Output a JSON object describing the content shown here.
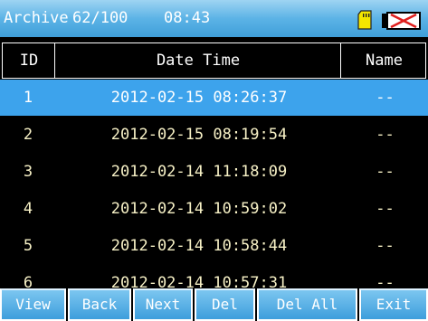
{
  "title_bar": {
    "title": "Archive",
    "record_count": "62/100",
    "time": "08:43",
    "icons": [
      "sd-card-icon",
      "battery-empty-icon"
    ],
    "colors": {
      "bar": "#4fa9e0",
      "sd_card": "#f3e600",
      "battery_x": "#e0201f"
    }
  },
  "table": {
    "columns": [
      "ID",
      "Date Time",
      "Name"
    ],
    "rows": [
      {
        "id": "1",
        "datetime": "2012-02-15 08:26:37",
        "name": "--",
        "selected": true
      },
      {
        "id": "2",
        "datetime": "2012-02-15 08:19:54",
        "name": "--",
        "selected": false
      },
      {
        "id": "3",
        "datetime": "2012-02-14 11:18:09",
        "name": "--",
        "selected": false
      },
      {
        "id": "4",
        "datetime": "2012-02-14 10:59:02",
        "name": "--",
        "selected": false
      },
      {
        "id": "5",
        "datetime": "2012-02-14 10:58:44",
        "name": "--",
        "selected": false
      },
      {
        "id": "6",
        "datetime": "2012-02-14 10:57:31",
        "name": "--",
        "selected": false
      }
    ],
    "colors": {
      "selected_row": "#3da3ec",
      "text": "#f7f1c6"
    }
  },
  "toolbar": {
    "buttons": [
      "View",
      "Back",
      "Next",
      "Del",
      "Del All",
      "Exit"
    ]
  }
}
